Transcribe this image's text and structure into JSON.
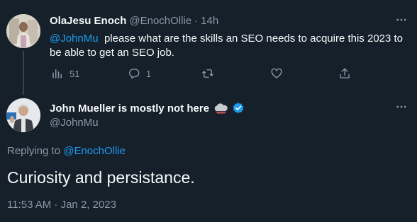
{
  "parent_tweet": {
    "display_name": "OlaJesu Enoch",
    "handle": "@EnochOllie",
    "separator": "·",
    "time": "14h",
    "mention": "@JohnMu",
    "text_line1": "please what are the skills an SEO needs to acquire this 2023 to",
    "text_line2": "be able to get an SEO job.",
    "actions": {
      "analytics_count": "51",
      "reply_count": "1",
      "retweet_count": "",
      "like_count": ""
    }
  },
  "main_tweet": {
    "display_name": "John Mueller is mostly not here",
    "handle": "@JohnMu",
    "replying_to_label": "Replying to",
    "replying_to_handle": "@EnochOllie",
    "text": "Curiosity and persistance.",
    "timestamp": "11:53 AM · Jan 2, 2023"
  },
  "colors": {
    "background": "#15202b",
    "text_primary": "#f7f9f9",
    "text_secondary": "#8b98a5",
    "accent": "#1d9bf0",
    "thread_line": "#38444d"
  },
  "icons": [
    "more-icon",
    "analytics-icon",
    "reply-icon",
    "retweet-icon",
    "like-icon",
    "share-icon",
    "cloud-emoji-icon",
    "verified-badge-icon"
  ]
}
